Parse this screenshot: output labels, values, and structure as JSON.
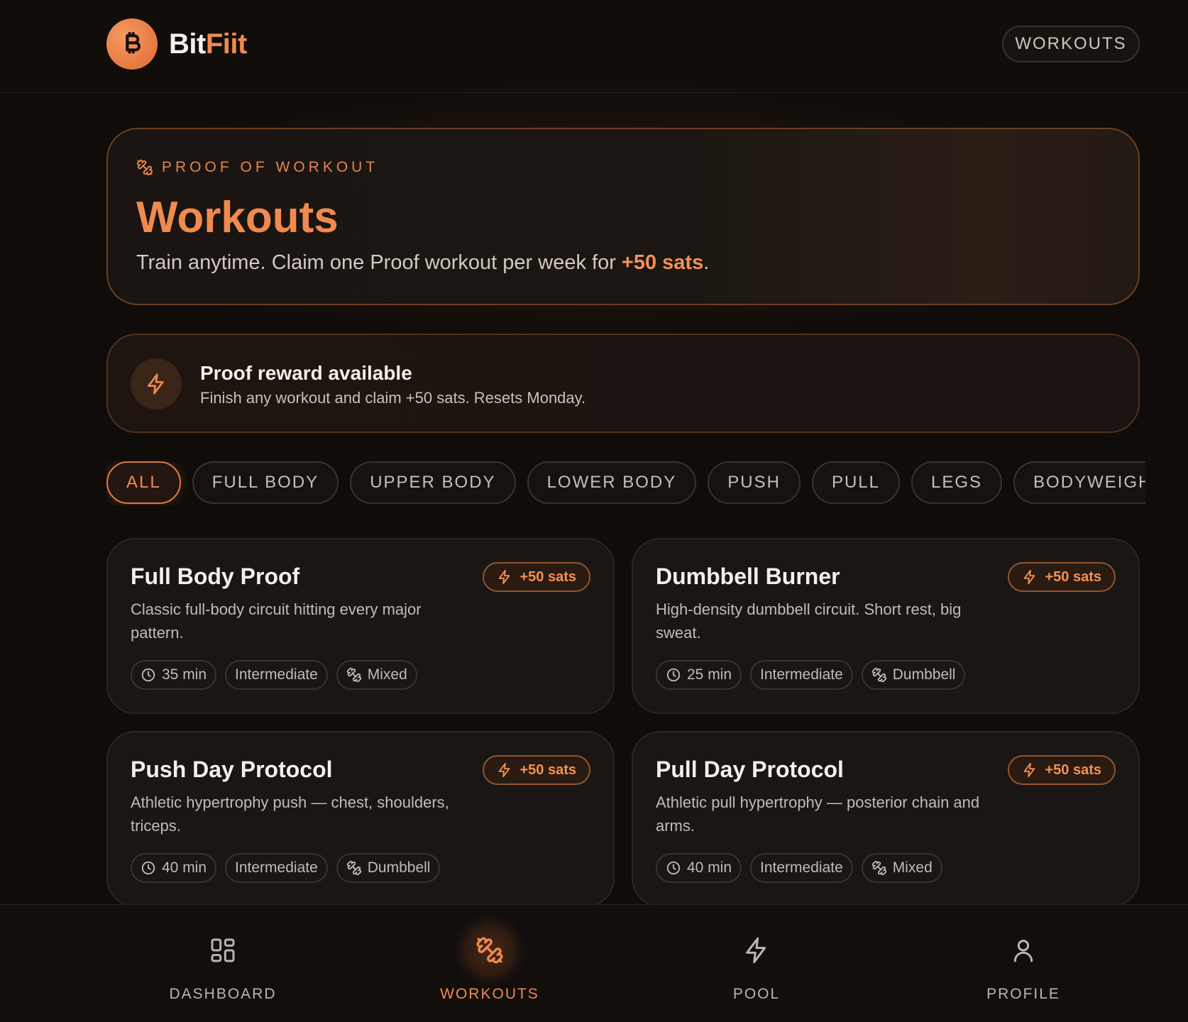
{
  "header": {
    "brand_part1": "Bit",
    "brand_part2": "Fiit",
    "logo_icon": "bitcoin-icon",
    "nav_pill": "WORKOUTS"
  },
  "hero": {
    "eyebrow": "PROOF OF WORKOUT",
    "title": "Workouts",
    "subtitle_prefix": "Train anytime. Claim one Proof workout per week for ",
    "subtitle_highlight": "+50 sats",
    "subtitle_suffix": "."
  },
  "reward": {
    "icon": "lightning-icon",
    "title": "Proof reward available",
    "subtitle": "Finish any workout and claim +50 sats. Resets Monday."
  },
  "filters": [
    {
      "label": "ALL",
      "active": true
    },
    {
      "label": "FULL BODY",
      "active": false
    },
    {
      "label": "UPPER BODY",
      "active": false
    },
    {
      "label": "LOWER BODY",
      "active": false
    },
    {
      "label": "PUSH",
      "active": false
    },
    {
      "label": "PULL",
      "active": false
    },
    {
      "label": "LEGS",
      "active": false
    },
    {
      "label": "BODYWEIGHT",
      "active": false
    }
  ],
  "workouts": [
    {
      "title": "Full Body Proof",
      "badge": "+50 sats",
      "description": "Classic full-body circuit hitting every major pattern.",
      "duration": "35 min",
      "level": "Intermediate",
      "equipment": "Mixed"
    },
    {
      "title": "Dumbbell Burner",
      "badge": "+50 sats",
      "description": "High-density dumbbell circuit. Short rest, big sweat.",
      "duration": "25 min",
      "level": "Intermediate",
      "equipment": "Dumbbell"
    },
    {
      "title": "Push Day Protocol",
      "badge": "+50 sats",
      "description": "Athletic hypertrophy push — chest, shoulders, triceps.",
      "duration": "40 min",
      "level": "Intermediate",
      "equipment": "Dumbbell"
    },
    {
      "title": "Pull Day Protocol",
      "badge": "+50 sats",
      "description": "Athletic pull hypertrophy — posterior chain and arms.",
      "duration": "40 min",
      "level": "Intermediate",
      "equipment": "Mixed"
    }
  ],
  "bottom_nav": [
    {
      "label": "DASHBOARD",
      "icon": "grid-icon",
      "active": false
    },
    {
      "label": "WORKOUTS",
      "icon": "dumbbell-icon",
      "active": true
    },
    {
      "label": "POOL",
      "icon": "lightning-icon",
      "active": false
    },
    {
      "label": "PROFILE",
      "icon": "user-icon",
      "active": false
    }
  ],
  "colors": {
    "accent": "#f08a4f",
    "background": "#0f0c0a",
    "card": "#1a1613"
  }
}
